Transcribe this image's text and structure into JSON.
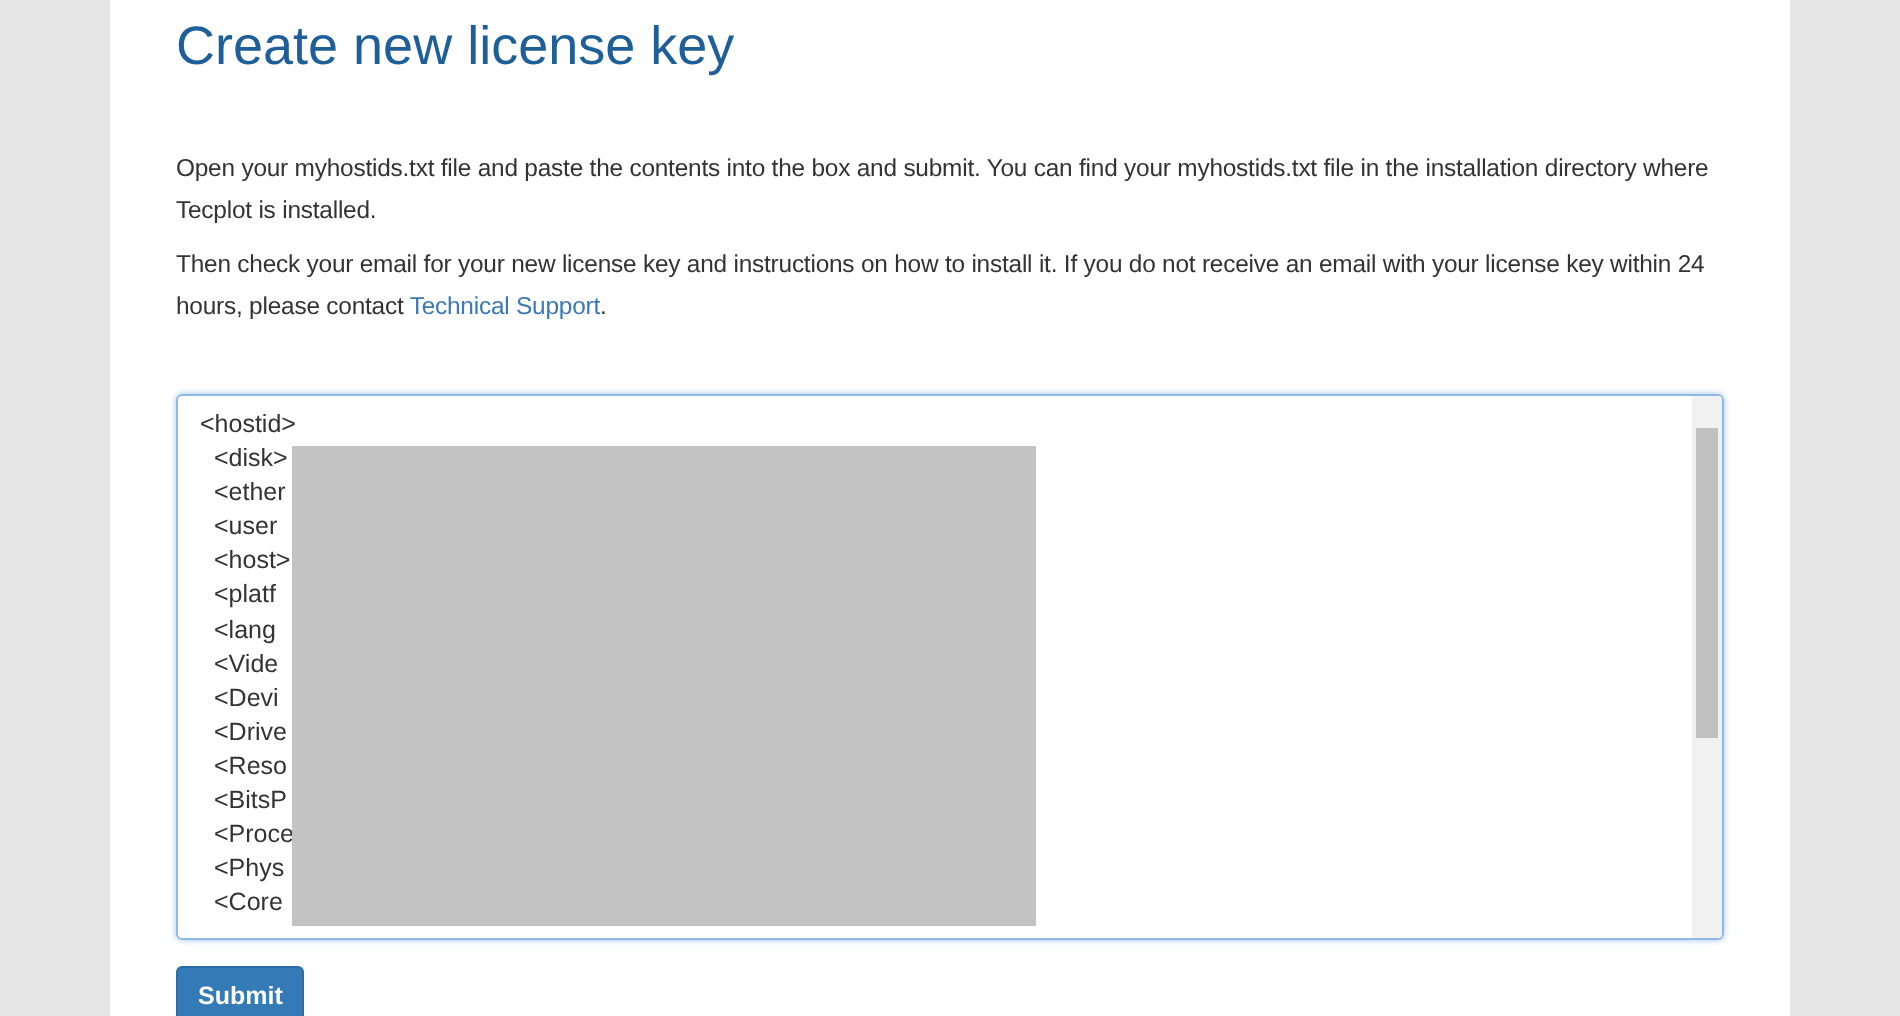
{
  "title": "Create new license key",
  "paragraphs": [
    {
      "text": "Open your myhostids.txt file and paste the contents into the box and submit. You can find your myhostids.txt file in the installation directory where Tecplot is installed."
    },
    {
      "text": "Then check your email for your new license key and instructions on how to install it. If you do not receive an email with your license key within 24 hours, please contact ",
      "link": "Technical Support",
      "after": "."
    }
  ],
  "hostids_box": {
    "lines": [
      "<hostid>",
      "<disk>",
      "<ether",
      "<user",
      "<host>",
      "<platf",
      "<lang",
      "<Vide",
      "<Devi",
      "<Drive",
      "<Reso",
      "<BitsP",
      "<Proce",
      "<Phys",
      "<Core"
    ]
  },
  "submit_button": "Submit"
}
